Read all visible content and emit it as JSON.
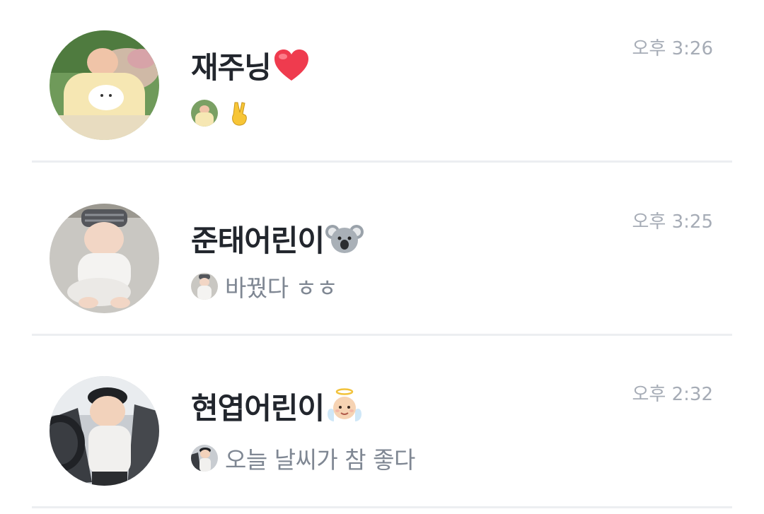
{
  "chats": [
    {
      "name": "재주닝",
      "name_emoji": "heart-emoji",
      "time": "오후 3:26",
      "preview_text": "",
      "preview_emoji": "victory-hand-emoji"
    },
    {
      "name": "준태어린이",
      "name_emoji": "koala-emoji",
      "time": "오후 3:25",
      "preview_text": "바꿨다 ㅎㅎ"
    },
    {
      "name": "현엽어린이",
      "name_emoji": "baby-angel-emoji",
      "time": "오후 2:32",
      "preview_text": "오늘 날씨가 참 좋다"
    }
  ],
  "colors": {
    "name": "#22262d",
    "time": "#a6acb6",
    "preview": "#7f8793",
    "divider": "#eceef1",
    "heart": "#ef3b4e"
  }
}
